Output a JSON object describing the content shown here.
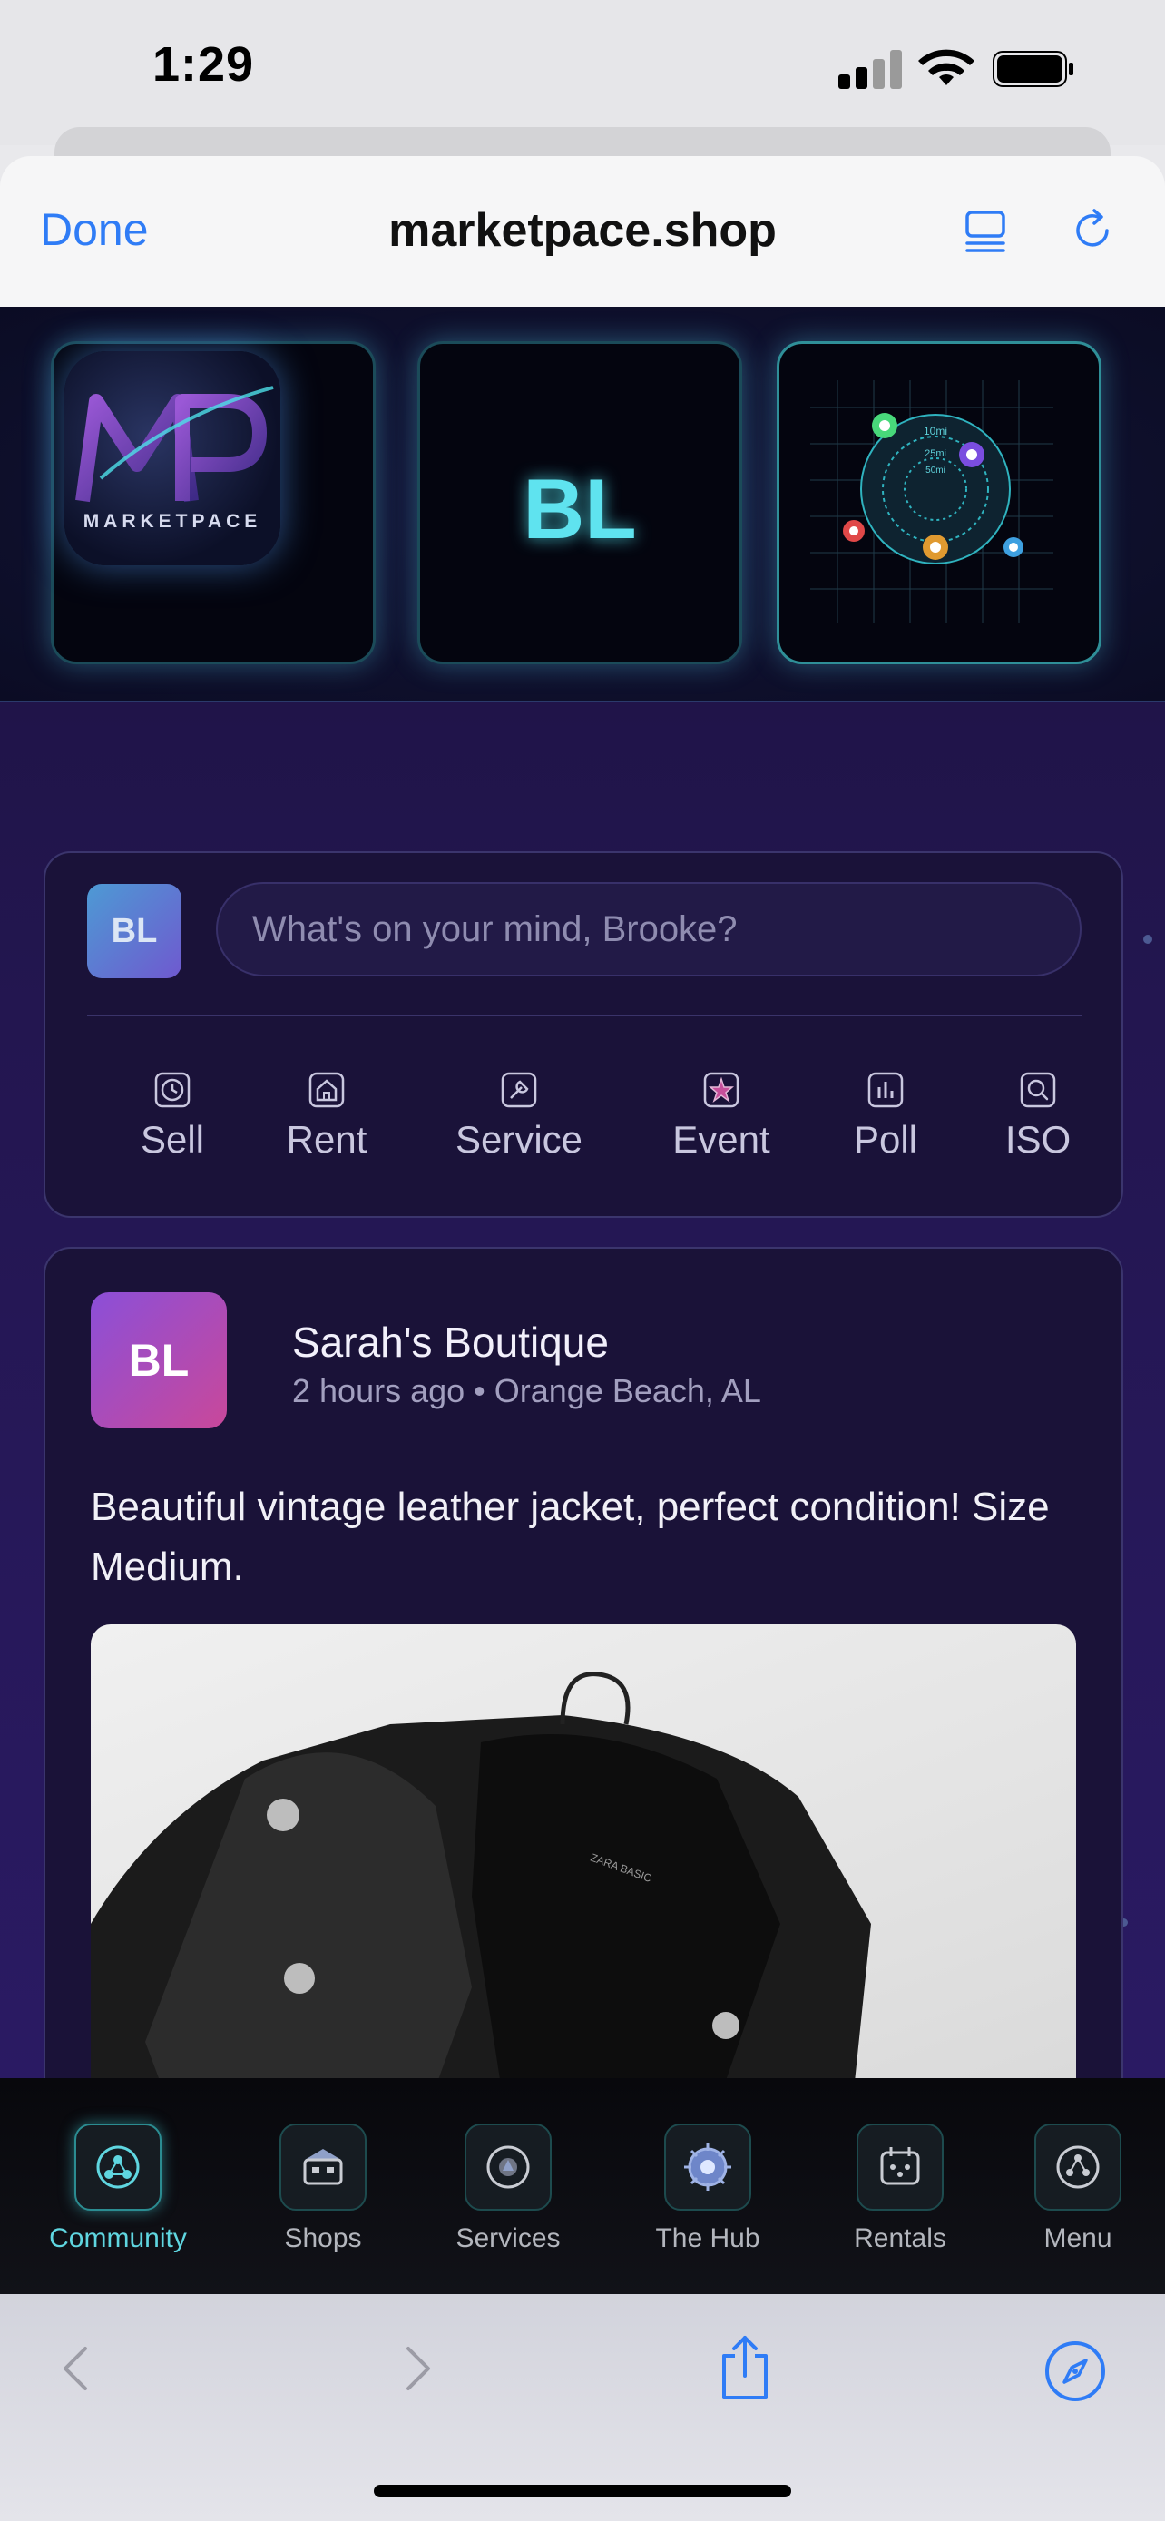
{
  "status_bar": {
    "time": "1:29"
  },
  "browser": {
    "done_label": "Done",
    "url": "marketpace.shop"
  },
  "hero": {
    "logo_text": "MARKETPACE",
    "logo_monogram": "MP",
    "initials": "BL",
    "radar_labels": [
      "10mi",
      "25mi",
      "50mi"
    ]
  },
  "composer": {
    "avatar_initials": "BL",
    "placeholder": "What's on your mind, Brooke?",
    "actions": [
      "Sell",
      "Rent",
      "Service",
      "Event",
      "Poll",
      "ISO"
    ]
  },
  "post": {
    "avatar_initials": "BL",
    "author": "Sarah's Boutique",
    "meta": "2 hours ago • Orange Beach, AL",
    "text": "Beautiful vintage leather jacket, perfect condition! Size Medium.",
    "image_label": "ZARA BASIC"
  },
  "tabs": [
    {
      "label": "Community",
      "icon": "community-icon",
      "active": true
    },
    {
      "label": "Shops",
      "icon": "shops-icon"
    },
    {
      "label": "Services",
      "icon": "services-icon"
    },
    {
      "label": "The Hub",
      "icon": "hub-icon"
    },
    {
      "label": "Rentals",
      "icon": "rentals-icon"
    },
    {
      "label": "Menu",
      "icon": "menu-icon"
    }
  ],
  "colors": {
    "accent_blue": "#2f7cf6",
    "accent_cyan": "#5fe3ef",
    "background_purple": "#231650"
  }
}
